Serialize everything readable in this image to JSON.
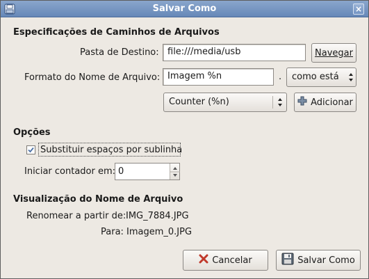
{
  "window": {
    "title": "Salvar Como"
  },
  "paths": {
    "section_title": "Especificações de Caminhos de Arquivos",
    "dest_label": "Pasta de Destino:",
    "dest_value": "file:///media/usb",
    "browse_button": "Navegar",
    "format_label": "Formato do Nome de Arquivo:",
    "format_value": "Imagem %n",
    "dot": ".",
    "extension_selected": "como está",
    "token_selected": "Counter (%n)",
    "add_button": "Adicionar"
  },
  "options": {
    "section_title": "Opções",
    "replace_spaces_label": "Substituir espaços por sublinha",
    "replace_spaces_checked": true,
    "counter_label": "Iniciar contador em:",
    "counter_value": "0"
  },
  "preview": {
    "section_title": "Visualização do Nome de Arquivo",
    "from_label": "Renomear a partir de:",
    "from_value": "IMG_7884.JPG",
    "to_label": "Para:",
    "to_value": "Imagem_0.JPG"
  },
  "buttons": {
    "cancel": "Cancelar",
    "save": "Salvar Como"
  },
  "icons": {
    "window": "save-dialog-icon",
    "close": "close-icon",
    "add": "plus-icon",
    "cancel": "cancel-x-icon",
    "save": "floppy-disk-icon",
    "check": "checkmark-icon"
  }
}
